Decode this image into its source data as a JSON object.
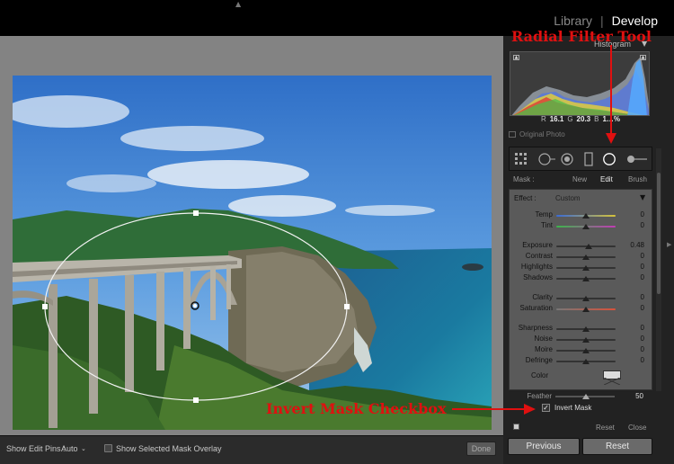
{
  "top": {
    "modules": [
      "Library",
      "Develop"
    ],
    "active_module": "Develop"
  },
  "annotations": {
    "radial_filter_tool": "Radial Filter Tool",
    "invert_mask_checkbox": "Invert Mask Checkbox"
  },
  "histogram": {
    "title": "Histogram",
    "readout": {
      "r_label": "R",
      "r": "16.1",
      "g_label": "G",
      "g": "20.3",
      "b_label": "B",
      "b": "1…%"
    },
    "original_photo": "Original Photo"
  },
  "tools": [
    "crop-overlay-icon",
    "spot-removal-icon",
    "red-eye-icon",
    "graduated-filter-icon",
    "radial-filter-icon",
    "adjustment-brush-icon"
  ],
  "mask": {
    "label": "Mask :",
    "new": "New",
    "edit": "Edit",
    "brush": "Brush",
    "active": "Edit"
  },
  "effect": {
    "label": "Effect :",
    "value": "Custom"
  },
  "sliders": [
    {
      "label": "Temp",
      "value": "0",
      "pos": 0.5
    },
    {
      "label": "Tint",
      "value": "0",
      "pos": 0.5
    },
    {
      "label": "Exposure",
      "value": "0.48",
      "pos": 0.55
    },
    {
      "label": "Contrast",
      "value": "0",
      "pos": 0.5
    },
    {
      "label": "Highlights",
      "value": "0",
      "pos": 0.5
    },
    {
      "label": "Shadows",
      "value": "0",
      "pos": 0.5
    },
    {
      "label": "Clarity",
      "value": "0",
      "pos": 0.5
    },
    {
      "label": "Saturation",
      "value": "0",
      "pos": 0.5
    },
    {
      "label": "Sharpness",
      "value": "0",
      "pos": 0.5
    },
    {
      "label": "Noise",
      "value": "0",
      "pos": 0.5
    },
    {
      "label": "Moire",
      "value": "0",
      "pos": 0.5
    },
    {
      "label": "Defringe",
      "value": "0",
      "pos": 0.5
    }
  ],
  "color": {
    "label": "Color"
  },
  "feather": {
    "label": "Feather",
    "value": "50",
    "pos": 0.5
  },
  "invert_mask": {
    "label": "Invert Mask",
    "checked": true
  },
  "panel_footer": {
    "reset": "Reset",
    "close": "Close"
  },
  "bottom_toolbar": {
    "show_edit_pins_label": "Show Edit Pins :",
    "show_edit_pins_value": "Auto",
    "show_mask_overlay": "Show Selected Mask Overlay",
    "done": "Done"
  },
  "buttons": {
    "previous": "Previous",
    "reset": "Reset"
  }
}
